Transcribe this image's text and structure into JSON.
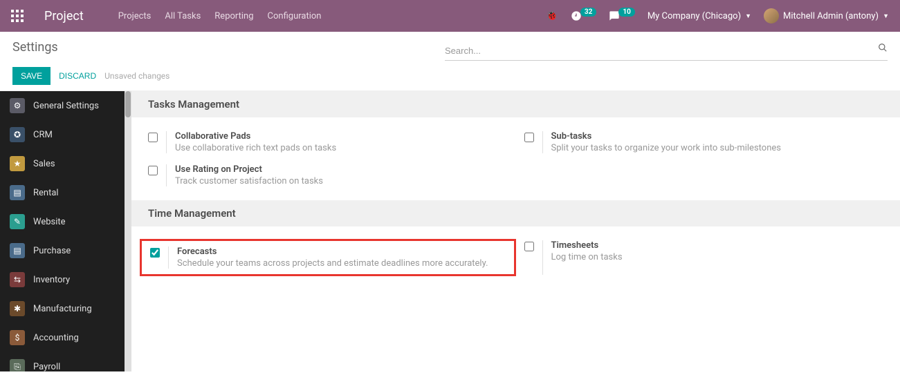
{
  "topbar": {
    "brand": "Project",
    "nav": [
      "Projects",
      "All Tasks",
      "Reporting",
      "Configuration"
    ],
    "badge1": "32",
    "badge2": "10",
    "company": "My Company (Chicago)",
    "user": "Mitchell Admin (antony)"
  },
  "control": {
    "title": "Settings",
    "save": "SAVE",
    "discard": "DISCARD",
    "unsaved": "Unsaved changes",
    "search_placeholder": "Search..."
  },
  "sidebar": [
    {
      "label": "General Settings",
      "color": "#5b5b66",
      "glyph": "⚙"
    },
    {
      "label": "CRM",
      "color": "#3a5068",
      "glyph": "✪"
    },
    {
      "label": "Sales",
      "color": "#c19a3f",
      "glyph": "★"
    },
    {
      "label": "Rental",
      "color": "#4a6b8a",
      "glyph": "▤"
    },
    {
      "label": "Website",
      "color": "#2b9e8f",
      "glyph": "✎"
    },
    {
      "label": "Purchase",
      "color": "#4a6b8a",
      "glyph": "▤"
    },
    {
      "label": "Inventory",
      "color": "#7a3b3b",
      "glyph": "⇆"
    },
    {
      "label": "Manufacturing",
      "color": "#6b4a2b",
      "glyph": "✱"
    },
    {
      "label": "Accounting",
      "color": "#8a5a3a",
      "glyph": "$"
    },
    {
      "label": "Payroll",
      "color": "#5a6b5a",
      "glyph": "⎘"
    }
  ],
  "sections": [
    {
      "title": "Tasks Management",
      "items": [
        {
          "title": "Collaborative Pads",
          "desc": "Use collaborative rich text pads on tasks",
          "checked": false,
          "highlight": false
        },
        {
          "title": "Sub-tasks",
          "desc": "Split your tasks to organize your work into sub-milestones",
          "checked": false,
          "highlight": false
        },
        {
          "title": "Use Rating on Project",
          "desc": "Track customer satisfaction on tasks",
          "checked": false,
          "highlight": false
        }
      ]
    },
    {
      "title": "Time Management",
      "items": [
        {
          "title": "Forecasts",
          "desc": "Schedule your teams across projects and estimate deadlines more accurately.",
          "checked": true,
          "highlight": true
        },
        {
          "title": "Timesheets",
          "desc": "Log time on tasks",
          "checked": false,
          "highlight": false
        }
      ]
    }
  ]
}
